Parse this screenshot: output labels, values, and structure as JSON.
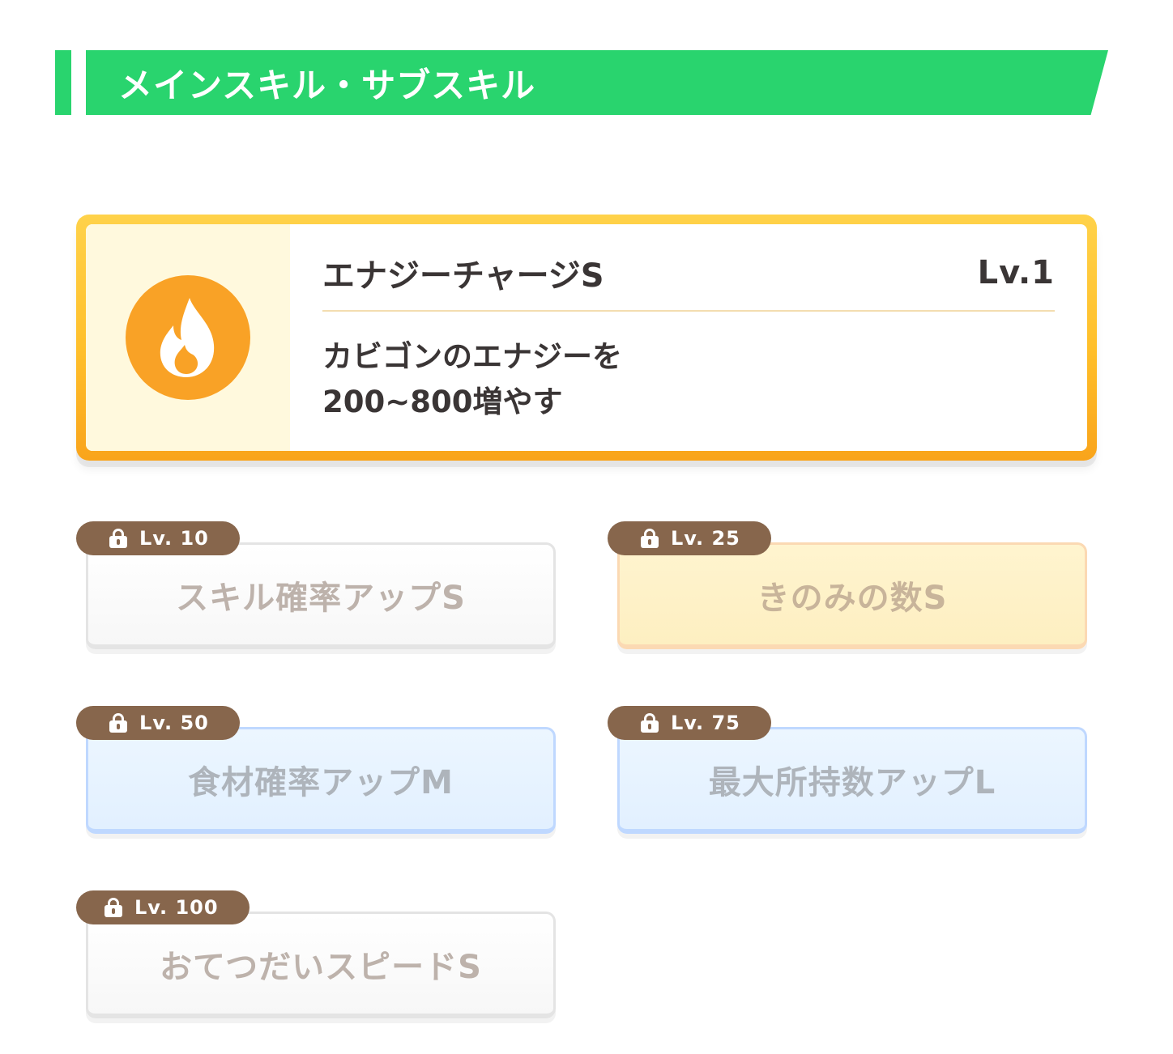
{
  "section": {
    "title": "メインスキル・サブスキル"
  },
  "main_skill": {
    "name": "エナジーチャージS",
    "level": "Lv.1",
    "description_line1": "カビゴンのエナジーを",
    "description_line2": "200~800増やす",
    "icon": "flame-icon",
    "icon_color": "#f9a226"
  },
  "sub_skills": [
    {
      "level": "Lv. 10",
      "label": "スキル確率アップS",
      "style": "white",
      "locked": true
    },
    {
      "level": "Lv. 25",
      "label": "きのみの数S",
      "style": "gold",
      "locked": true
    },
    {
      "level": "Lv. 50",
      "label": "食材確率アップM",
      "style": "blue",
      "locked": true
    },
    {
      "level": "Lv. 75",
      "label": "最大所持数アップL",
      "style": "blue",
      "locked": true
    },
    {
      "level": "Lv. 100",
      "label": "おてつだいスピードS",
      "style": "white",
      "locked": true
    }
  ],
  "colors": {
    "header_green": "#29d46e",
    "main_card_border": "#ffbf2a",
    "level_tag": "#87664c"
  }
}
